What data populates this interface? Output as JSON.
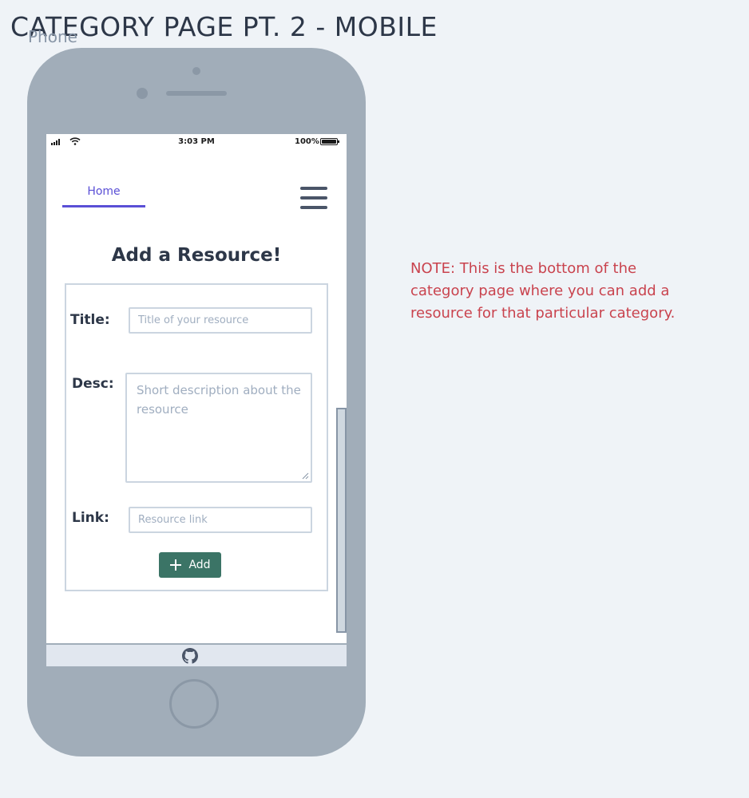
{
  "page": {
    "heading": "CATEGORY PAGE PT. 2 - MOBILE",
    "phone_label": "Phone"
  },
  "statusbar": {
    "time": "3:03 PM",
    "battery": "100%"
  },
  "nav": {
    "home_label": "Home"
  },
  "form": {
    "title": "Add a Resource!",
    "title_label": "Title:",
    "title_placeholder": "Title of your resource",
    "desc_label": "Desc:",
    "desc_placeholder": "Short description about the resource",
    "link_label": "Link:",
    "link_placeholder": "Resource link",
    "add_label": "Add"
  },
  "note": "NOTE: This is the bottom of the category page where you can add a resource for that particular category.",
  "colors": {
    "accent": "#5a4fd6",
    "button": "#3b7466",
    "note": "#c9434e"
  },
  "icons": [
    "signal-icon",
    "wifi-icon",
    "battery-icon",
    "hamburger-icon",
    "plus-icon",
    "github-icon"
  ]
}
